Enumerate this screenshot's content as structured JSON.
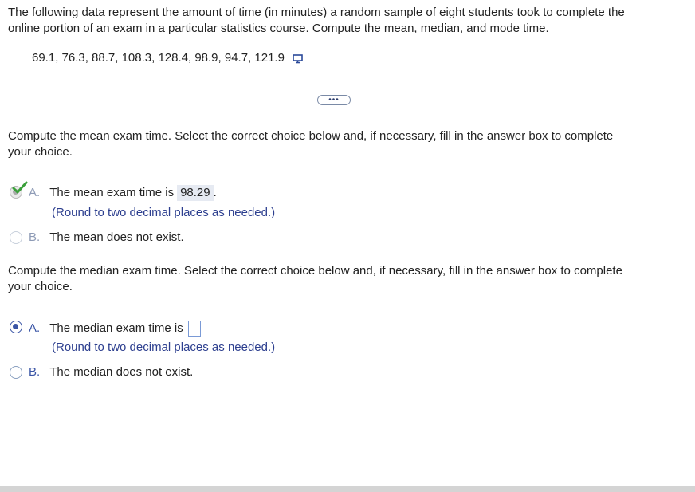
{
  "question": {
    "prompt_line1": "The following data represent the amount of time (in minutes) a random sample of eight students took to complete the",
    "prompt_line2": "online portion of an exam in a particular statistics course. Compute the mean, median, and mode time.",
    "data_values": "69.1, 76.3, 88.7, 108.3, 128.4, 98.9, 94.7, 121.9",
    "copy_icon": "copy-data-icon",
    "expand_button_label": "•••"
  },
  "mean_part": {
    "instruction_line1": "Compute the mean exam time. Select the correct choice below and, if necessary, fill in the answer box to complete",
    "instruction_line2": "your choice.",
    "choice_a": {
      "letter": "A.",
      "text": "The mean exam time is",
      "answer": "98.29",
      "suffix": ".",
      "hint": "(Round to two decimal places as needed.)",
      "status": "correct"
    },
    "choice_b": {
      "letter": "B.",
      "text": "The mean does not exist."
    }
  },
  "median_part": {
    "instruction_line1": "Compute the median exam time. Select the correct choice below and, if necessary, fill in the answer box to complete",
    "instruction_line2": "your choice.",
    "choice_a": {
      "letter": "A.",
      "text": "The median exam time is",
      "answer": "",
      "hint": "(Round to two decimal places as needed.)",
      "selected": true
    },
    "choice_b": {
      "letter": "B.",
      "text": "The median does not exist."
    }
  },
  "colors": {
    "accent": "#3a55a6",
    "hint_text": "#2d3f8f",
    "correct_check": "#3aa03a",
    "answer_highlight": "#e6eaf2"
  }
}
